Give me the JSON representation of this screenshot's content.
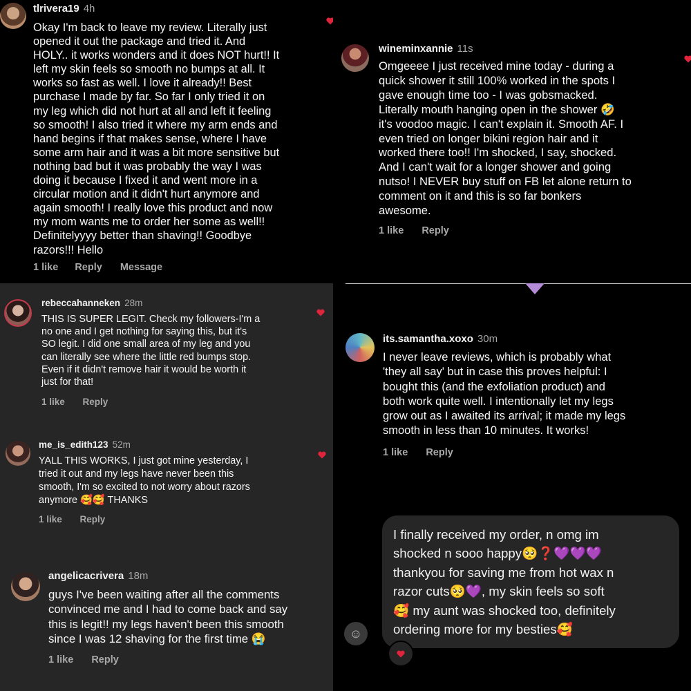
{
  "colors": {
    "heart": "#e0243b",
    "panel_black": "#000000",
    "panel_gray": "#262626",
    "purple": "#b38bd6"
  },
  "comments": [
    {
      "username": "tlrivera19",
      "time": "4h",
      "text": "Okay I'm back to leave my review. Literally just\nopened it out the package and tried it. And\nHOLY.. it works wonders and it does NOT hurt!! It\nleft my skin feels so smooth no bumps at all. It\nworks so fast as well. I love it already!! Best\npurchase I made by far. So far I only tried it on\nmy leg which did not hurt at all and left it feeling\nso smooth! I also tried it where my arm ends and\nhand begins if that makes sense, where I have\nsome arm hair and it was a bit more sensitive but\nnothing bad but it was probably the way I was\ndoing it because I fixed it and went more in a\ncircular motion and it didn't hurt anymore and\nagain smooth! I really love this product and now\nmy mom wants me to order her some as well!!\nDefinitelyyyy better than shaving!! Goodbye\nrazors!!! Hello",
      "likes": "1 like",
      "reply": "Reply",
      "message": "Message"
    },
    {
      "username": "wineminxannie",
      "time": "11s",
      "text": "Omgeeee I just received mine today - during a\nquick shower it still 100% worked in the spots I\ngave enough time too - I was gobsmacked.\nLiterally mouth hanging open in the shower 🤣\nit's voodoo magic. I can't explain it. Smooth AF. I\neven tried on longer bikini region hair and it\nworked there too!! I'm shocked, I say, shocked.\nAnd I can't wait for a longer shower and going\nnutso! I NEVER buy stuff on FB let alone return to\ncomment on it and this is so far bonkers\nawesome.",
      "likes": "1 like",
      "reply": "Reply"
    },
    {
      "username": "rebeccahanneken",
      "time": "28m",
      "text": "THIS IS SUPER LEGIT. Check my followers-I'm a\nno one and I get nothing for saying this, but it's\nSO legit. I did one small area of my leg and you\ncan literally see where the little red bumps stop.\nEven if it didn't remove hair it would be worth it\njust for that!",
      "likes": "1 like",
      "reply": "Reply"
    },
    {
      "username": "me_is_edith123",
      "time": "52m",
      "text": "YALL THIS WORKS, I just got mine yesterday, I\ntried it out and my legs have never been this\nsmooth, I'm so excited to not worry about razors\nanymore 🥰🥰 THANKS",
      "likes": "1 like",
      "reply": "Reply"
    },
    {
      "username": "angelicacrivera",
      "time": "18m",
      "text": "guys I've been waiting after all the comments\nconvinced me and I had to come back and say\nthis is legit!! my legs haven't been this smooth\nsince I was 12 shaving for the first time 😭",
      "likes": "1 like",
      "reply": "Reply"
    },
    {
      "username": "its.samantha.xoxo",
      "time": "30m",
      "text": "I never leave reviews, which is probably what\n'they all say' but in case this proves helpful: I\nbought this (and the exfoliation product) and\nboth work quite well. I intentionally let my legs\ngrow out as I awaited its arrival; it made my legs\nsmooth in less than 10 minutes. It works!",
      "likes": "1 like",
      "reply": "Reply"
    }
  ],
  "message_bubble": {
    "text": "I finally received my order, n omg im\nshocked n sooo happy🥺❓💜💜💜\nthankyou for saving me from hot wax n\nrazor cuts🥺💜, my skin feels so soft\n🥰 my aunt was shocked too, definitely\nordering more for my besties🥰"
  }
}
